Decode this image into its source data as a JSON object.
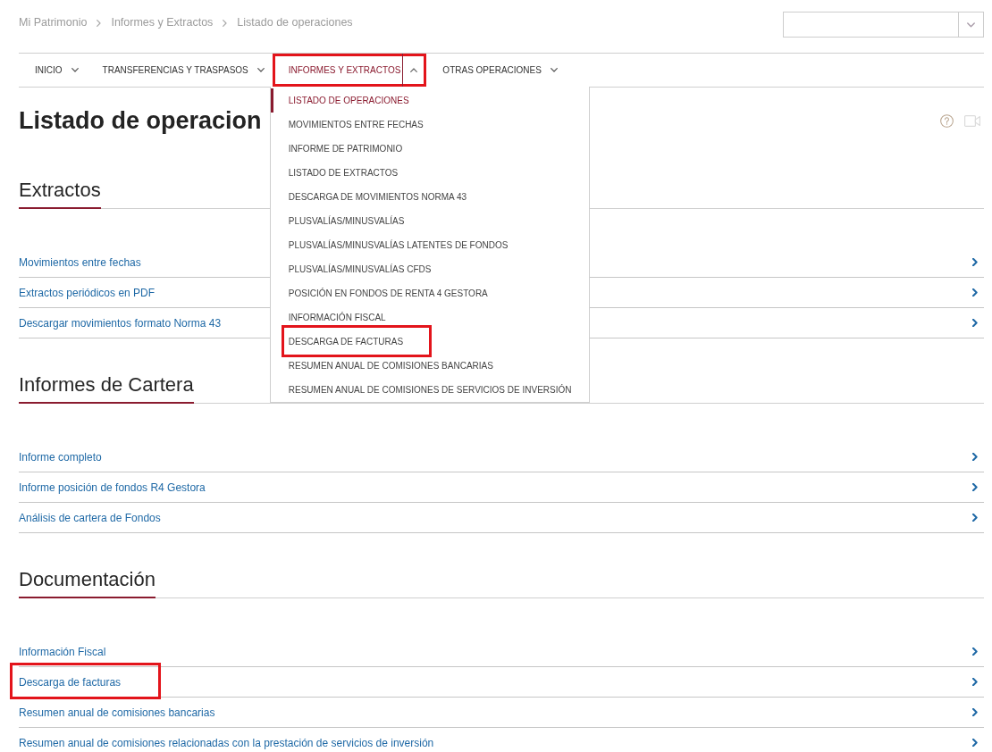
{
  "breadcrumb": [
    {
      "label": "Mi Patrimonio"
    },
    {
      "label": "Informes y Extractos"
    },
    {
      "label": "Listado de operaciones"
    }
  ],
  "top_select": {
    "expanded": false
  },
  "nav": [
    {
      "label": "INICIO",
      "selected": false,
      "expanded": false,
      "highlighted": false
    },
    {
      "label": "TRANSFERENCIAS Y TRASPASOS",
      "selected": false,
      "expanded": false,
      "highlighted": false
    },
    {
      "label": "INFORMES Y EXTRACTOS",
      "selected": true,
      "expanded": true,
      "highlighted": true,
      "menu": [
        {
          "label": "LISTADO DE OPERACIONES",
          "selected": true,
          "highlighted": false
        },
        {
          "label": "MOVIMIENTOS ENTRE FECHAS",
          "selected": false,
          "highlighted": false
        },
        {
          "label": "INFORME DE PATRIMONIO",
          "selected": false,
          "highlighted": false
        },
        {
          "label": "LISTADO DE EXTRACTOS",
          "selected": false,
          "highlighted": false
        },
        {
          "label": "DESCARGA DE MOVIMIENTOS NORMA 43",
          "selected": false,
          "highlighted": false
        },
        {
          "label": "PLUSVALÍAS/MINUSVALÍAS",
          "selected": false,
          "highlighted": false
        },
        {
          "label": "PLUSVALÍAS/MINUSVALÍAS LATENTES DE FONDOS",
          "selected": false,
          "highlighted": false
        },
        {
          "label": "PLUSVALÍAS/MINUSVALÍAS CFDS",
          "selected": false,
          "highlighted": false
        },
        {
          "label": "POSICIÓN EN FONDOS DE RENTA 4 GESTORA",
          "selected": false,
          "highlighted": false
        },
        {
          "label": "INFORMACIÓN FISCAL",
          "selected": false,
          "highlighted": false
        },
        {
          "label": "DESCARGA DE FACTURAS",
          "selected": false,
          "highlighted": true
        },
        {
          "label": "RESUMEN ANUAL DE COMISIONES BANCARIAS",
          "selected": false,
          "highlighted": false
        },
        {
          "label": "RESUMEN ANUAL DE COMISIONES DE SERVICIOS DE INVERSIÓN",
          "selected": false,
          "highlighted": false
        }
      ]
    },
    {
      "label": "OTRAS OPERACIONES",
      "selected": false,
      "expanded": false,
      "highlighted": false
    }
  ],
  "page": {
    "title": "Listado de operacion"
  },
  "sections": [
    {
      "heading": "Extractos",
      "links": [
        {
          "label": "Movimientos entre fechas",
          "highlighted": false
        },
        {
          "label": "Extractos periódicos en PDF",
          "highlighted": false
        },
        {
          "label": "Descargar movimientos formato Norma 43",
          "highlighted": false
        }
      ]
    },
    {
      "heading": "Informes de Cartera",
      "links": [
        {
          "label": "Informe completo",
          "highlighted": false
        },
        {
          "label": "Informe posición de fondos R4 Gestora",
          "highlighted": false
        },
        {
          "label": "Análisis de cartera de Fondos",
          "highlighted": false
        }
      ]
    },
    {
      "heading": "Documentación",
      "links": [
        {
          "label": "Información Fiscal",
          "highlighted": false
        },
        {
          "label": "Descarga de facturas",
          "highlighted": true
        },
        {
          "label": "Resumen anual de comisiones bancarias",
          "highlighted": false
        },
        {
          "label": "Resumen anual de comisiones relacionadas con la prestación de servicios de inversión",
          "highlighted": false
        }
      ]
    }
  ]
}
